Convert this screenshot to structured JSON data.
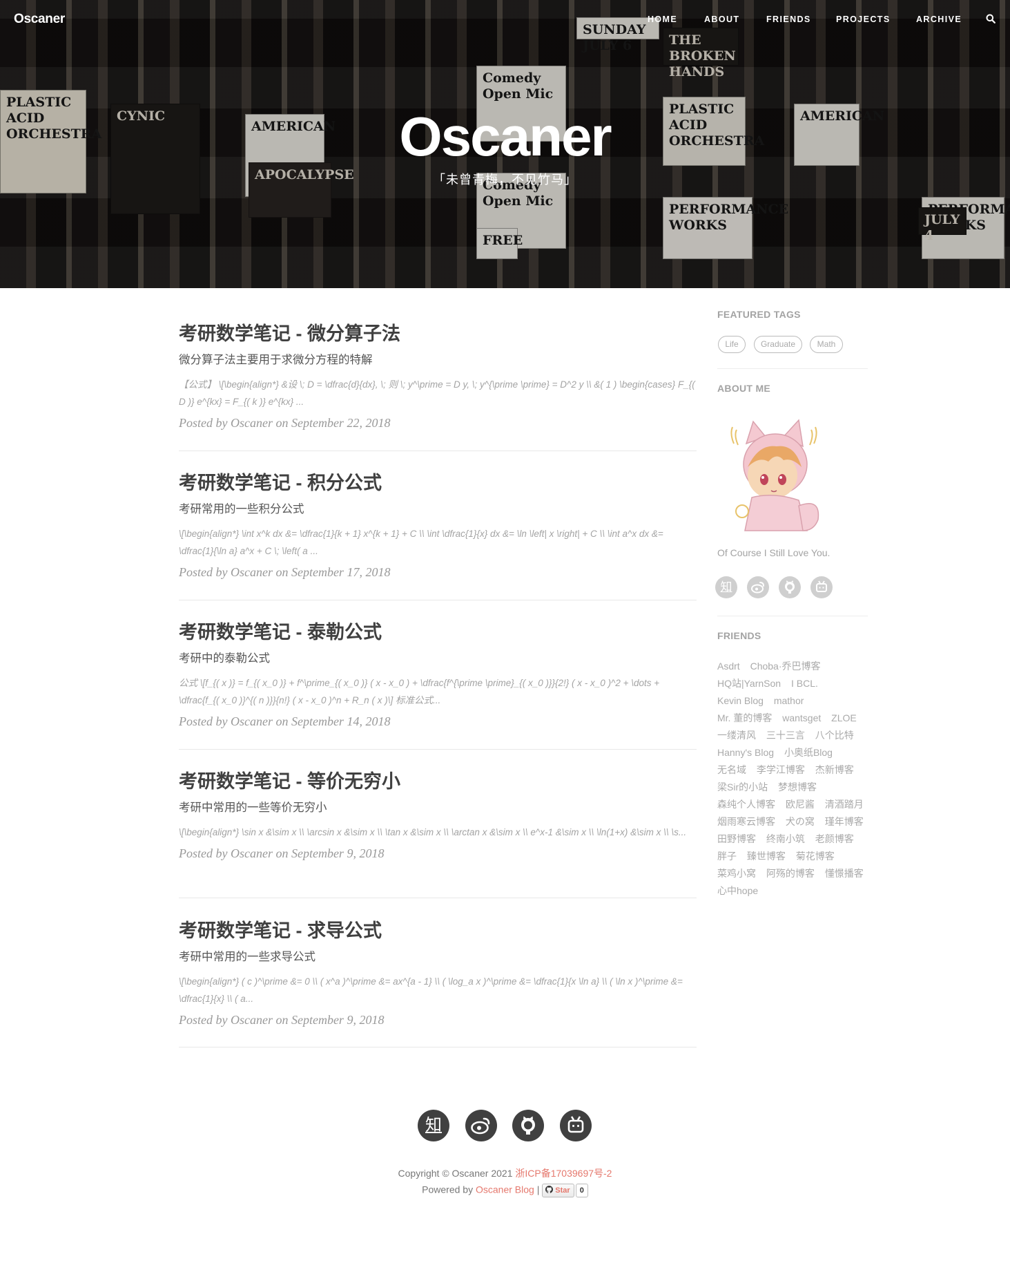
{
  "nav": {
    "brand": "Oscaner",
    "items": [
      "HOME",
      "ABOUT",
      "FRIENDS",
      "PROJECTS",
      "ARCHIVE"
    ],
    "search_icon": "search-icon"
  },
  "hero": {
    "title": "Oscaner",
    "subtitle": "「未曾青梅，不见竹马」",
    "posters": [
      "Comedy Open Mic",
      "PLASTIC ACID ORCHESTRA",
      "CYNIC",
      "AMERICAN",
      "APOCALYPSE",
      "Comedy Open Mic",
      "FREE",
      "PERFORMANCE WORKS",
      "SUNDAY JULY 6",
      "THE BROKEN HANDS",
      "PLASTIC ACID ORCHESTRA",
      "AMERICAN",
      "PERFORMANCE WORKS",
      "JULY 4"
    ]
  },
  "posts": [
    {
      "title": "考研数学笔记 - 微分算子法",
      "subtitle": "微分算子法主要用于求微分方程的特解",
      "excerpt": "【公式】 \\[\\begin{align*} &设 \\; D = \\dfrac{d}{dx}, \\; 则 \\; y^\\prime = D y, \\; y^{\\prime \\prime} = D^2 y \\\\ &( 1 ) \\begin{cases} F_{( D )} e^{kx} = F_{( k )} e^{kx} ...",
      "meta": "Posted by Oscaner on September 22, 2018"
    },
    {
      "title": "考研数学笔记 - 积分公式",
      "subtitle": "考研常用的一些积分公式",
      "excerpt": "\\[\\begin{align*} \\int x^k dx &= \\dfrac{1}{k + 1} x^{k + 1} + C \\\\ \\int \\dfrac{1}{x} dx &= \\ln \\left| x \\right| + C \\\\ \\int a^x dx &= \\dfrac{1}{\\ln a} a^x + C \\; \\left( a ...",
      "meta": "Posted by Oscaner on September 17, 2018"
    },
    {
      "title": "考研数学笔记 - 泰勒公式",
      "subtitle": "考研中的泰勒公式",
      "excerpt": "公式 \\[f_{( x )} = f_{( x_0 )} + f^\\prime_{( x_0 )} ( x - x_0 ) + \\dfrac{f^{\\prime \\prime}_{( x_0 )}}{2!} ( x - x_0 )^2 + \\dots + \\dfrac{f_{( x_0 )}^{( n )}}{n!} ( x - x_0 )^n + R_n ( x )\\] 标准公式...",
      "meta": "Posted by Oscaner on September 14, 2018"
    },
    {
      "title": "考研数学笔记 - 等价无穷小",
      "subtitle": "考研中常用的一些等价无穷小",
      "excerpt": "\\[\\begin{align*} \\sin x &\\sim x \\\\ \\arcsin x &\\sim x \\\\ \\tan x &\\sim x \\\\ \\arctan x &\\sim x \\\\ e^x-1 &\\sim x \\\\ \\ln(1+x) &\\sim x \\\\ \\s...",
      "meta": "Posted by Oscaner on September 9, 2018"
    },
    {
      "title": "考研数学笔记 - 求导公式",
      "subtitle": "考研中常用的一些求导公式",
      "excerpt": "\\[\\begin{align*} ( c )^\\prime &= 0 \\\\ ( x^a )^\\prime &= ax^{a - 1} \\\\ ( \\log_a x )^\\prime &= \\dfrac{1}{x \\ln a} \\\\ ( \\ln x )^\\prime &= \\dfrac{1}{x} \\\\ ( a...",
      "meta": "Posted by Oscaner on September 9, 2018"
    }
  ],
  "sidebar": {
    "featured_tags_heading": "FEATURED TAGS",
    "tags": [
      "Life",
      "Graduate",
      "Math"
    ],
    "about_heading": "ABOUT ME",
    "about_text": "Of Course I Still Love You.",
    "social": [
      "知",
      "weibo-icon",
      "github-icon",
      "bilibili-icon"
    ],
    "friends_heading": "FRIENDS",
    "friends": [
      "Asdrt",
      "Choba·乔巴博客",
      "HQ站|YarnSon",
      "I BCL.",
      "Kevin Blog",
      "mathor",
      "Mr. 董的博客",
      "wantsget",
      "ZLOE",
      "一缕清风",
      "三十三言",
      "八个比特",
      "Hanny's Blog",
      "小奥纸Blog",
      "无名域",
      "李学江博客",
      "杰新博客",
      "梁Sir的小站",
      "梦想博客",
      "森纯个人博客",
      "欧尼酱",
      "清酒踏月",
      "烟雨寒云博客",
      "犬の窝",
      "瑾年博客",
      "田野博客",
      "终南小筑",
      "老颜博客",
      "胖子",
      "臻世博客",
      "菊花博客",
      "菜鸡小窝",
      "阿殇的博客",
      "懂憬播客",
      "心中hope"
    ]
  },
  "footer": {
    "social_zhihu": "知",
    "copyright_prefix": "Copyright © Oscaner 2021",
    "icp": "浙ICP备17039697号-2",
    "powered_prefix": "Powered by",
    "powered_link": "Oscaner Blog",
    "separator": "|",
    "star_label": "Star",
    "star_count": "0"
  },
  "colors": {
    "link_accent": "#e5786d",
    "text_main": "#404040",
    "muted": "#a3a3a3"
  }
}
